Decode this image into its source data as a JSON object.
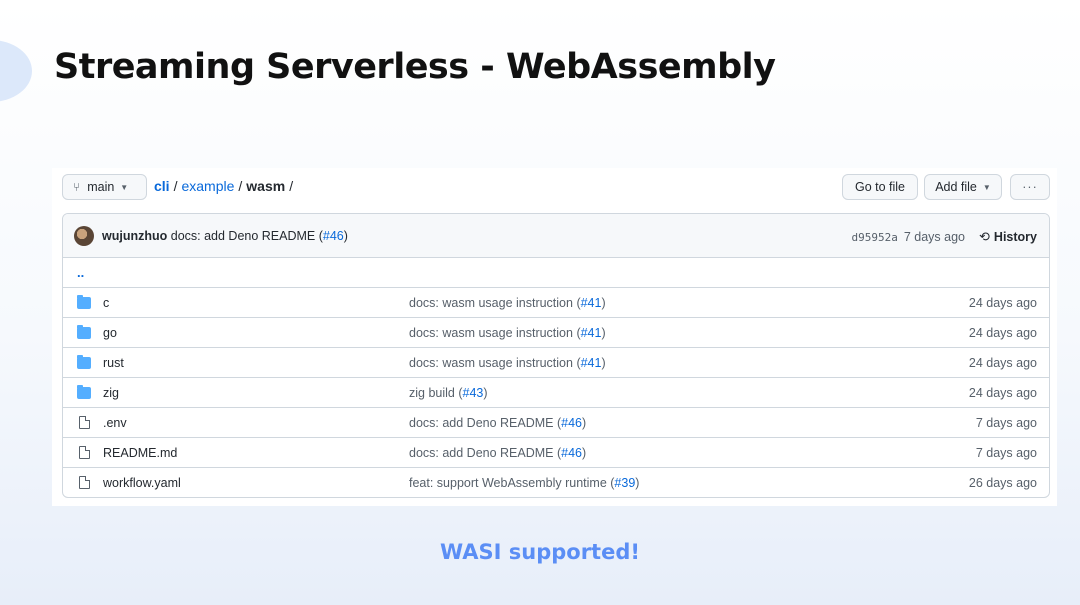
{
  "slide": {
    "title": "Streaming Serverless - WebAssembly",
    "caption": "WASI supported!"
  },
  "toolbar": {
    "branch": "main",
    "breadcrumb": {
      "root": "cli",
      "middle": "example",
      "current": "wasm",
      "sep": "/"
    },
    "go_to_file": "Go to file",
    "add_file": "Add file",
    "more": "···"
  },
  "commit": {
    "author": "wujunzhuo",
    "message": "docs: add Deno README (",
    "pr": "#46",
    "close": ")",
    "sha": "d95952a",
    "time": "7 days ago",
    "history": "History"
  },
  "parent_dir": "..",
  "files": [
    {
      "type": "folder",
      "name": "c",
      "msg": "docs: wasm usage instruction (",
      "pr": "#41",
      "age": "24 days ago"
    },
    {
      "type": "folder",
      "name": "go",
      "msg": "docs: wasm usage instruction (",
      "pr": "#41",
      "age": "24 days ago"
    },
    {
      "type": "folder",
      "name": "rust",
      "msg": "docs: wasm usage instruction (",
      "pr": "#41",
      "age": "24 days ago"
    },
    {
      "type": "folder",
      "name": "zig",
      "msg": "zig build (",
      "pr": "#43",
      "age": "24 days ago"
    },
    {
      "type": "file",
      "name": ".env",
      "msg": "docs: add Deno README (",
      "pr": "#46",
      "age": "7 days ago"
    },
    {
      "type": "file",
      "name": "README.md",
      "msg": "docs: add Deno README (",
      "pr": "#46",
      "age": "7 days ago"
    },
    {
      "type": "file",
      "name": "workflow.yaml",
      "msg": "feat: support WebAssembly runtime (",
      "pr": "#39",
      "age": "26 days ago"
    }
  ],
  "icons": {
    "branch": "git-branch-icon",
    "folder": "folder-icon",
    "file": "file-icon",
    "history": "clock-icon",
    "caret": "caret-down-icon"
  },
  "colors": {
    "link": "#0969da",
    "folder": "#54aeff",
    "caption": "#5b8ef5"
  }
}
